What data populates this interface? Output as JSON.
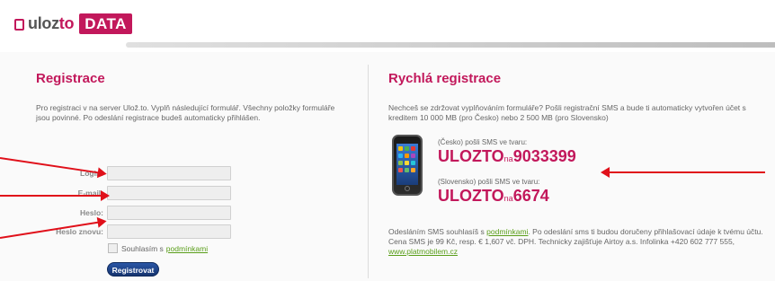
{
  "header": {
    "logo_main": "uloz",
    "logo_accent": "to",
    "logo_badge": "DATA"
  },
  "left": {
    "title": "Registrace",
    "intro": "Pro registraci v na server Ulož.to. Vyplň následující formulář. Všechny položky formuláře jsou povinné. Po odeslání registrace budeš automaticky přihlášen.",
    "fields": [
      {
        "label": "Login:",
        "value": ""
      },
      {
        "label": "E-mail:",
        "value": ""
      },
      {
        "label": "Heslo:",
        "value": ""
      },
      {
        "label": "Heslo znovu:",
        "value": ""
      }
    ],
    "agree_text": "Souhlasím s",
    "agree_link": "podmínkami",
    "submit_label": "Registrovat"
  },
  "right": {
    "title": "Rychlá registrace",
    "intro": "Nechceš se zdržovat vyplňováním formuláře? Pošli registrační SMS a bude ti automaticky vytvořen účet s kreditem 10 000 MB (pro Česko) nebo 2 500 MB (pro Slovensko)",
    "sms": [
      {
        "label": "(Česko) pošli SMS ve tvaru:",
        "keyword": "ULOZTO",
        "na": "na",
        "number": "9033399"
      },
      {
        "label": "(Slovensko) pošli SMS ve tvaru:",
        "keyword": "ULOZTO",
        "na": "na",
        "number": "6674"
      }
    ],
    "footer_pre": "Odesláním SMS souhlasíš s",
    "footer_link": "podmínkami",
    "footer_post": ". Po odeslání sms ti budou doručeny přihlašovací údaje k tvému účtu. Cena SMS je 99 Kč, resp. € 1,607 vč. DPH. Technicky zajišťuje Airtoy a.s. Infolinka +420 602 777 555,",
    "footer_url": "www.platmobilem.cz"
  },
  "colors": {
    "accent": "#c2185b",
    "arrow": "#e0101a",
    "link": "#5a9e1a",
    "button": "#15336e"
  }
}
